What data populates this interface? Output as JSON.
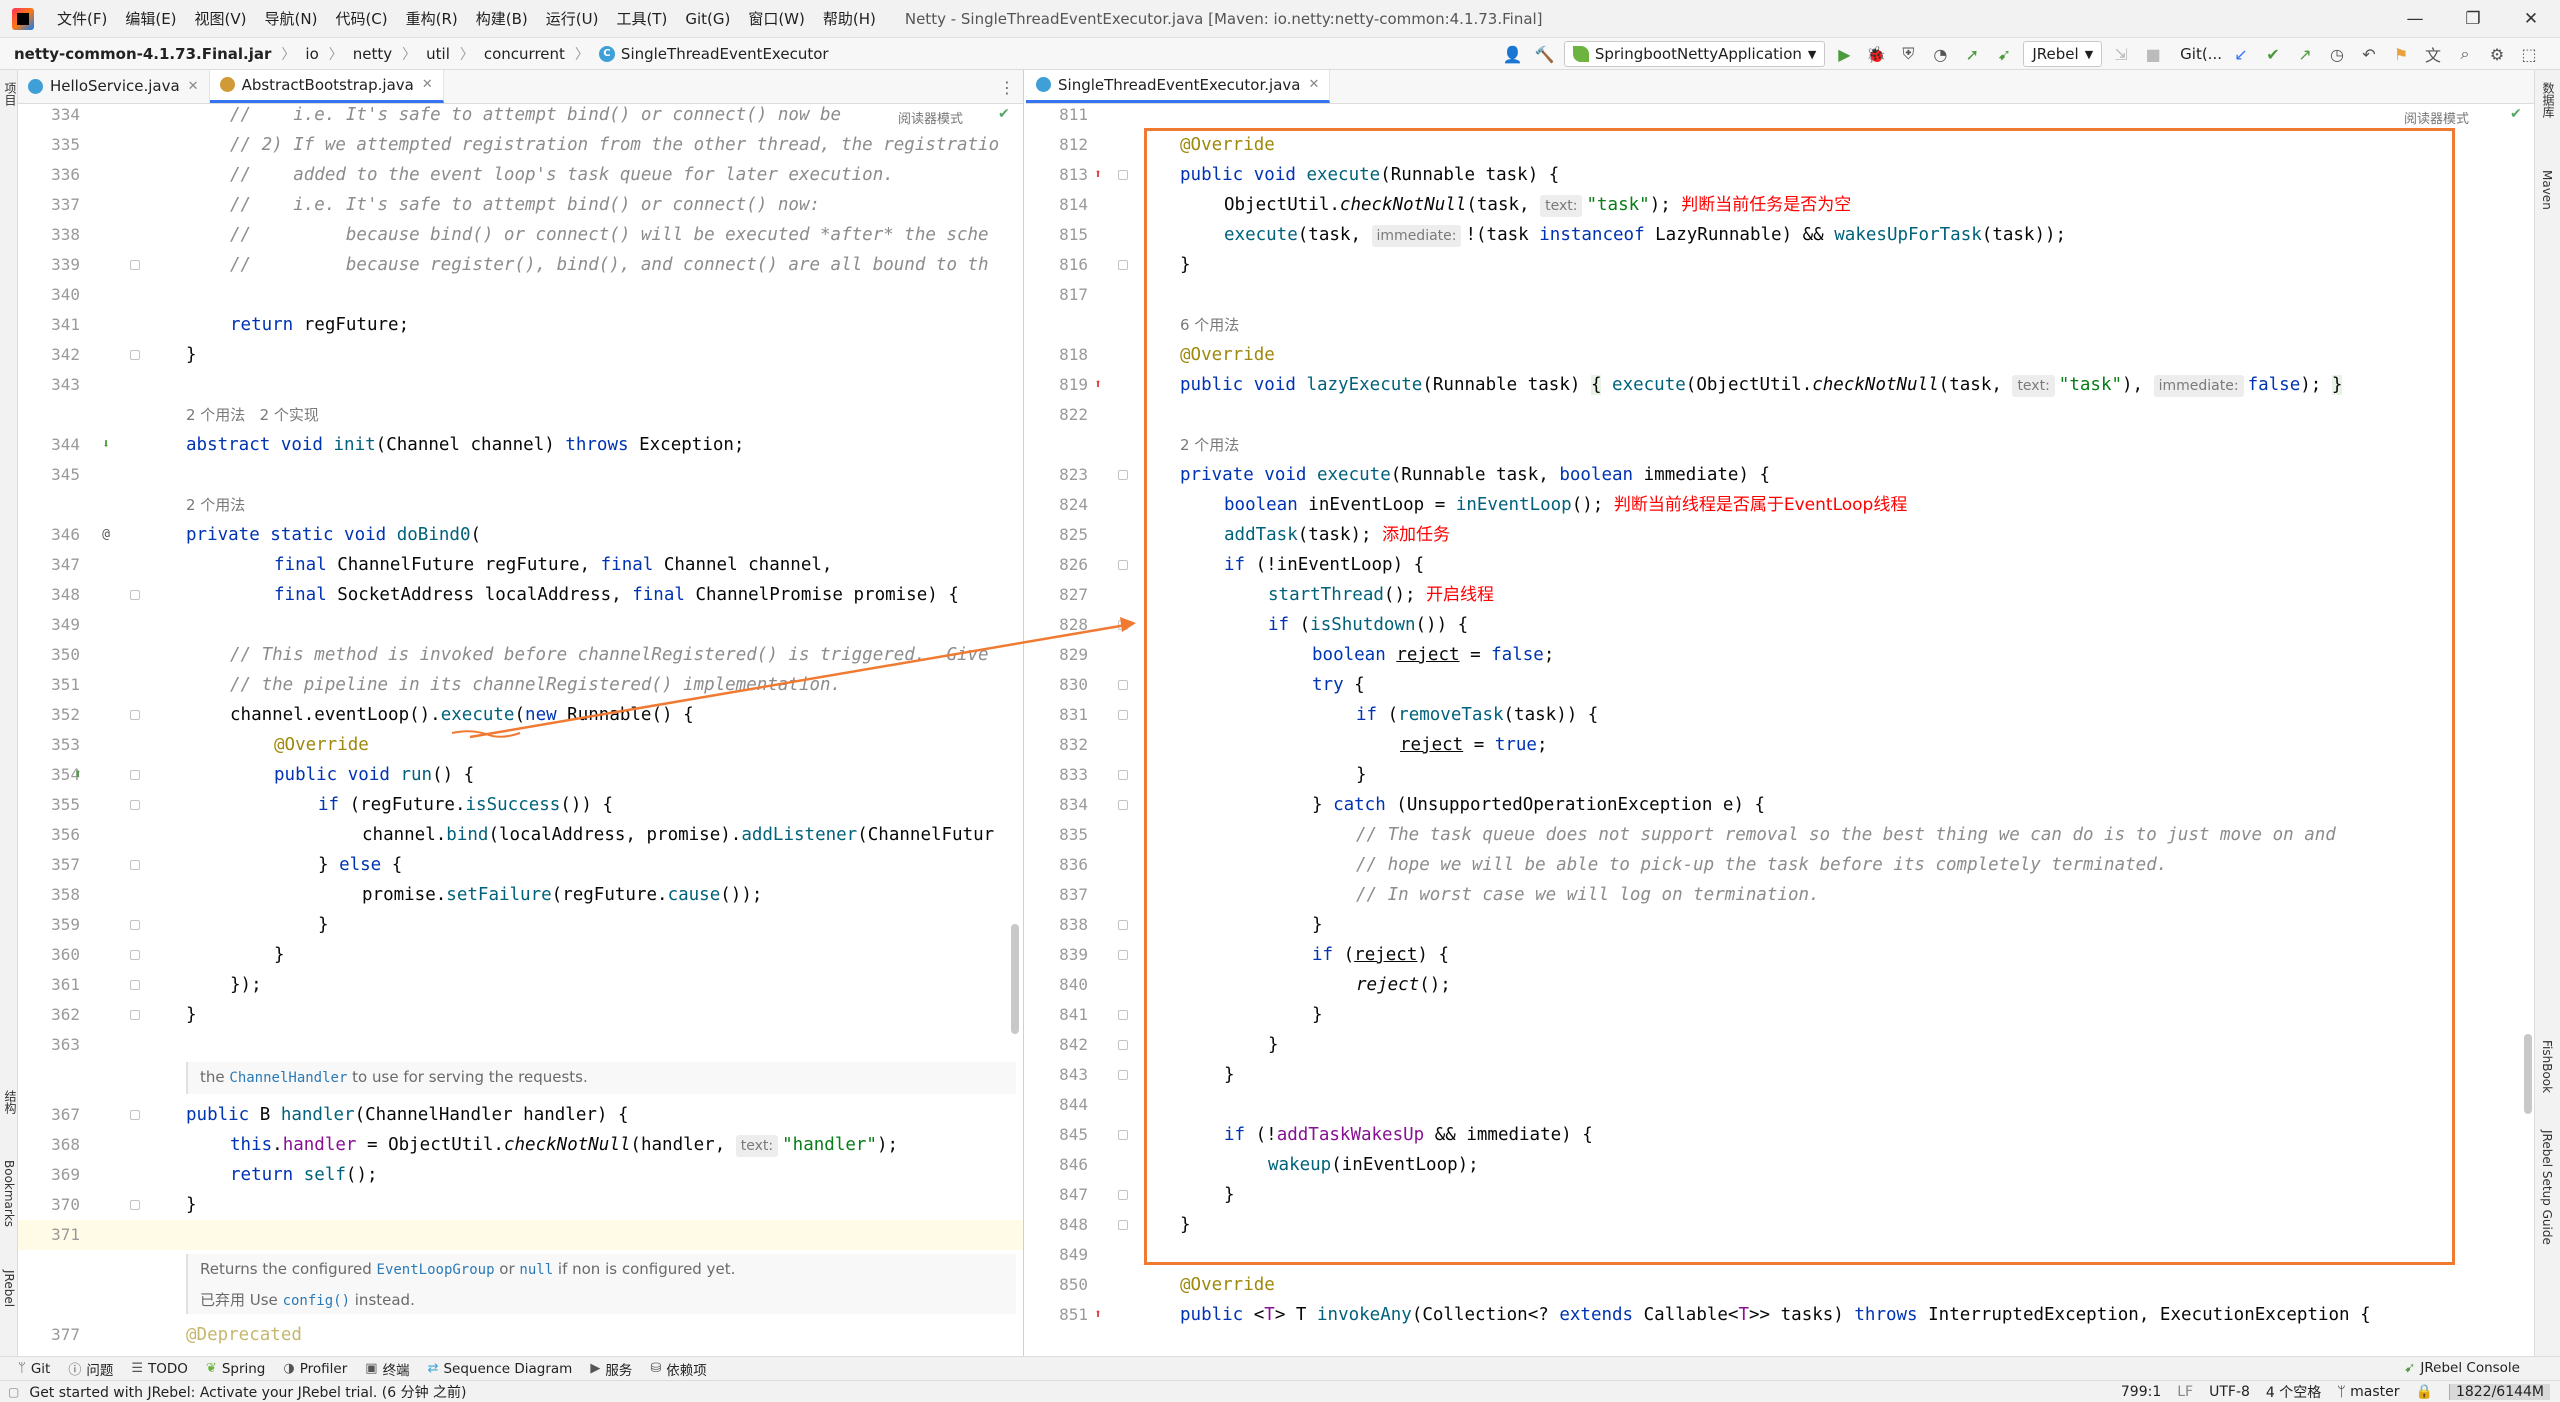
{
  "menu": {
    "items": [
      "文件(F)",
      "编辑(E)",
      "视图(V)",
      "导航(N)",
      "代码(C)",
      "重构(R)",
      "构建(B)",
      "运行(U)",
      "工具(T)",
      "Git(G)",
      "窗口(W)",
      "帮助(H)"
    ],
    "window_title": "Netty - SingleThreadEventExecutor.java [Maven: io.netty:netty-common:4.1.73.Final]"
  },
  "breadcrumb": [
    "netty-common-4.1.73.Final.jar",
    "io",
    "netty",
    "util",
    "concurrent",
    "SingleThreadEventExecutor"
  ],
  "toolbar": {
    "run_config": "SpringbootNettyApplication",
    "jrebel": "JRebel",
    "git": "Git(..."
  },
  "left_strip": [
    "项目",
    "结构",
    "Bookmarks",
    "JRebel"
  ],
  "right_strip": [
    "数据库",
    "Maven",
    "FishBook",
    "JRebel Setup Guide"
  ],
  "left_editor": {
    "tabs": [
      {
        "label": "HelloService.java",
        "active": false
      },
      {
        "label": "AbstractBootstrap.java",
        "active": true
      }
    ],
    "reader_mode": "阅读器模式",
    "usage_344": "2 个用法   2 个实现",
    "usage_346": "2 个用法",
    "doc_handler_pre": "the ",
    "doc_handler_code": "ChannelHandler",
    "doc_handler_post": " to use for serving the requests.",
    "doc_group_pre": "Returns the configured ",
    "doc_group_code1": "EventLoopGroup",
    "doc_group_mid": " or ",
    "doc_group_code2": "null",
    "doc_group_post": " if non is configured yet.",
    "doc_deprecated_pre": "已弃用 Use ",
    "doc_deprecated_code": "config()",
    "doc_deprecated_post": " instead.",
    "line_numbers": [
      "334",
      "335",
      "336",
      "337",
      "338",
      "339",
      "340",
      "341",
      "342",
      "343",
      "344",
      "345",
      "346",
      "347",
      "348",
      "349",
      "350",
      "351",
      "352",
      "353",
      "354",
      "355",
      "356",
      "357",
      "358",
      "359",
      "360",
      "361",
      "362",
      "363",
      "367",
      "368",
      "369",
      "370",
      "371",
      "377"
    ]
  },
  "right_editor": {
    "tabs": [
      {
        "label": "SingleThreadEventExecutor.java",
        "active": true
      }
    ],
    "reader_mode": "阅读器模式",
    "usage_818": "6 个用法",
    "usage_823": "2 个用法",
    "note_814": "判断当前任务是否为空",
    "note_824": "判断当前线程是否属于EventLoop线程",
    "note_825": "添加任务",
    "note_827": "开启线程",
    "hint_text": "text:",
    "hint_immediate": "immediate:",
    "line_numbers": [
      "811",
      "812",
      "813",
      "814",
      "815",
      "816",
      "817",
      "818",
      "819",
      "822",
      "823",
      "824",
      "825",
      "826",
      "827",
      "828",
      "829",
      "830",
      "831",
      "832",
      "833",
      "834",
      "835",
      "836",
      "837",
      "838",
      "839",
      "840",
      "841",
      "842",
      "843",
      "844",
      "845",
      "846",
      "847",
      "848",
      "849",
      "850",
      "851"
    ]
  },
  "bottom_tools": [
    "Git",
    "问题",
    "TODO",
    "Spring",
    "Profiler",
    "终端",
    "Sequence Diagram",
    "服务",
    "依赖项"
  ],
  "bottom_right_tool": "JRebel Console",
  "status": {
    "message": "Get started with JRebel: Activate your JRebel trial. (6 分钟 之前)",
    "position": "799:1",
    "line_sep": "LF",
    "encoding": "UTF-8",
    "indent": "4 个空格",
    "branch": "master",
    "memory": "1822/6144M"
  },
  "colors": {
    "highlight_box": "#f07a32",
    "annotation_red": "#ff0000",
    "keyword": "#0033b3",
    "annotation": "#9e880d",
    "string": "#067d17"
  }
}
